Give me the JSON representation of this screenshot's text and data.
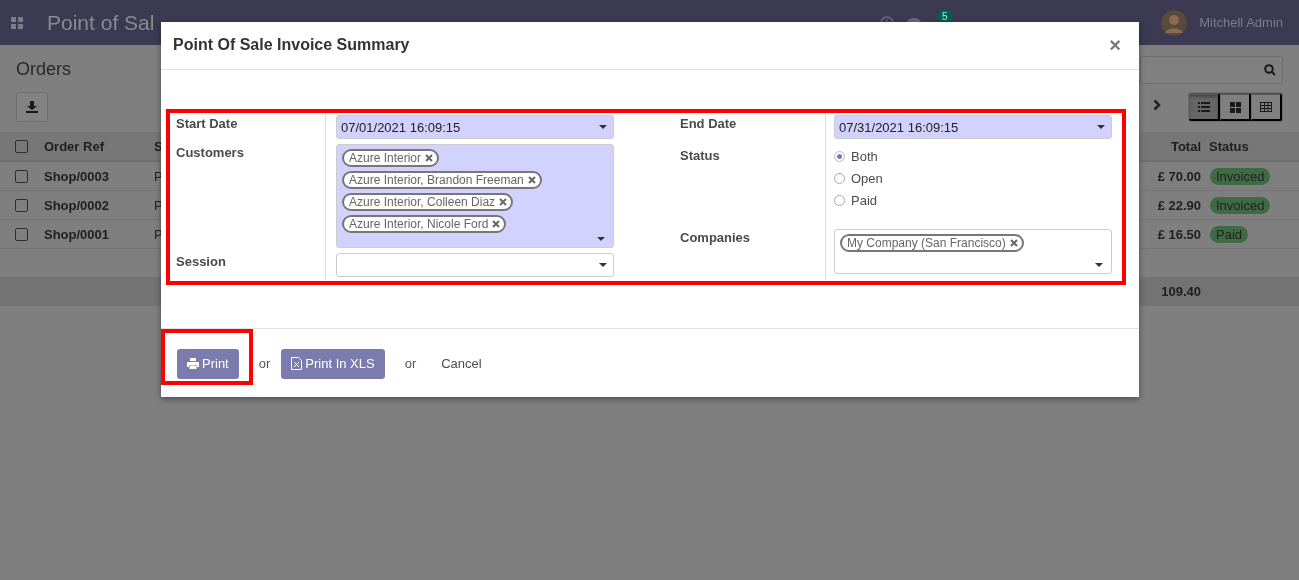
{
  "navbar": {
    "app_title": "Point of Sal",
    "notification_count": "5",
    "user": "Mitchell Admin"
  },
  "control_panel": {
    "title": "Orders",
    "views": [
      {
        "kind": "list",
        "selected": true
      },
      {
        "kind": "kanban",
        "selected": false
      },
      {
        "kind": "pivot",
        "selected": false
      }
    ]
  },
  "table": {
    "all_checked": false,
    "columns": [
      "Order Ref",
      "S",
      "Total",
      "Status"
    ],
    "rows": [
      {
        "checked": false,
        "order_ref": "Shop/0003",
        "column_3": "P",
        "total": "£ 70.00",
        "status": "Invoiced"
      },
      {
        "checked": false,
        "order_ref": "Shop/0002",
        "column_3": "P",
        "total": "£ 22.90",
        "status": "Invoiced"
      },
      {
        "checked": false,
        "order_ref": "Shop/0001",
        "column_3": "P",
        "total": "£ 16.50",
        "status": "Paid"
      }
    ],
    "footer_total": "109.40"
  },
  "dialog": {
    "title": "Point Of Sale Invoice Summary",
    "close": "×",
    "left_fields": [
      {
        "kind": "date",
        "label": "Start Date",
        "value": "07/01/2021 16:09:15",
        "required": true
      },
      {
        "kind": "tags",
        "label": "Customers",
        "required": true,
        "tags": [
          "Azure Interior",
          "Azure Interior, Brandon Freeman",
          "Azure Interior, Colleen Diaz",
          "Azure Interior, Nicole Ford"
        ]
      },
      {
        "kind": "select",
        "label": "Session",
        "required": false
      }
    ],
    "right_fields": [
      {
        "kind": "date",
        "label": "End Date",
        "value": "07/31/2021 16:09:15",
        "required": true
      },
      {
        "kind": "radio",
        "label": "Status",
        "options": [
          {
            "label": "Both",
            "selected": true
          },
          {
            "label": "Open",
            "selected": false
          },
          {
            "label": "Paid",
            "selected": false
          }
        ]
      },
      {
        "kind": "tags",
        "label": "Companies",
        "required": false,
        "tags": [
          "My Company (San Francisco)"
        ]
      }
    ],
    "footer": [
      {
        "kind": "print",
        "label": "Print"
      },
      {
        "kind": "sep",
        "label": "or"
      },
      {
        "kind": "xls",
        "label": "Print In XLS"
      },
      {
        "kind": "sep",
        "label": "or"
      },
      {
        "kind": "link",
        "label": "Cancel"
      }
    ]
  }
}
